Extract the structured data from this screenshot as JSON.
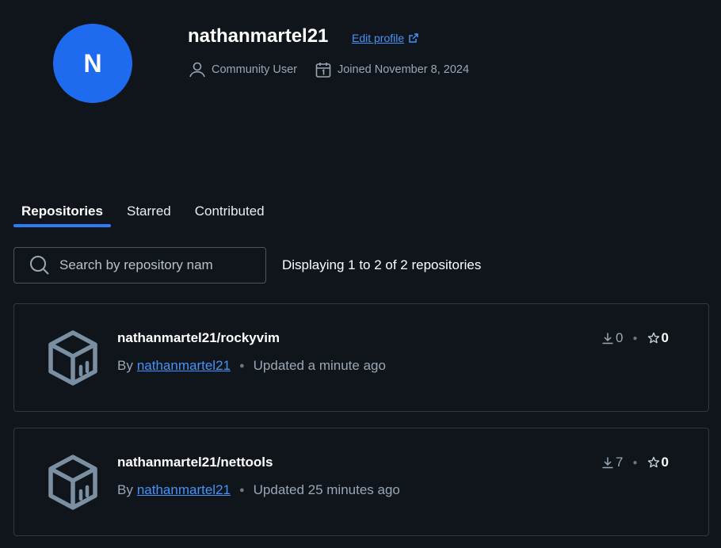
{
  "profile": {
    "avatar_letter": "N",
    "username": "nathanmartel21",
    "edit_profile_label": "Edit profile",
    "role": "Community User",
    "joined": "Joined November 8, 2024"
  },
  "tabs": [
    {
      "label": "Repositories",
      "active": true
    },
    {
      "label": "Starred",
      "active": false
    },
    {
      "label": "Contributed",
      "active": false
    }
  ],
  "search": {
    "placeholder": "Search by repository nam"
  },
  "display_count": "Displaying 1 to 2 of 2 repositories",
  "repositories": [
    {
      "name": "nathanmartel21/rockyvim",
      "by_label": "By",
      "owner": "nathanmartel21",
      "updated": "Updated a minute ago",
      "downloads": "0",
      "stars": "0"
    },
    {
      "name": "nathanmartel21/nettools",
      "by_label": "By",
      "owner": "nathanmartel21",
      "updated": "Updated 25 minutes ago",
      "downloads": "7",
      "stars": "0"
    }
  ],
  "colors": {
    "background": "#10151c",
    "avatar": "#1f6bf0",
    "link": "#4493f8",
    "tab_indicator": "#2f7bf5"
  },
  "icons": {
    "user": "user-icon",
    "calendar": "calendar-icon",
    "external_link": "external-link-icon",
    "search": "search-icon",
    "repo": "repository-box-icon",
    "download": "download-icon",
    "star": "star-icon"
  }
}
